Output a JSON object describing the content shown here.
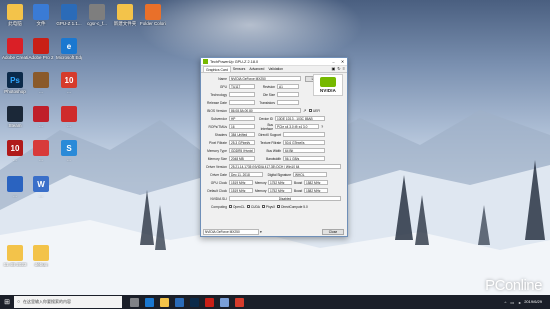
{
  "desktop_icons": [
    {
      "label": "此电脑",
      "color": "#f3c34a"
    },
    {
      "label": "文件",
      "color": "#3a7bd5"
    },
    {
      "label": "GPU-Z 1.1...",
      "color": "#2b6bb8"
    },
    {
      "label": "cgsr-c_f...",
      "color": "#7e7e7e"
    },
    {
      "label": "新建文件夹",
      "color": "#f3c34a"
    },
    {
      "label": "Folder Colorizer BitmapSystem",
      "color": "#e9702a"
    },
    {
      "label": "Adobe Creative Cloud",
      "color": "#da1f26"
    },
    {
      "label": "Adobe Pro 2",
      "color": "#c91f16"
    },
    {
      "label": "Microsoft Edge",
      "color": "#1b78d0"
    },
    {
      "label": "Photoshop",
      "color": "#0b2a4a"
    },
    {
      "label": "...",
      "color": "#8a5a2a"
    },
    {
      "label": "...",
      "color": "#d63b2b"
    },
    {
      "label": "Steam",
      "color": "#1b2838"
    },
    {
      "label": "...",
      "color": "#c01f2a"
    },
    {
      "label": "...",
      "color": "#cf2b2b"
    },
    {
      "label": "...",
      "color": "#b01a1a"
    },
    {
      "label": "...",
      "color": "#d83a3a"
    },
    {
      "label": "...",
      "color": "#2a8ad8"
    },
    {
      "label": "...",
      "color": "#2a63c0"
    },
    {
      "label": "...",
      "color": "#3a6fc9"
    },
    {
      "label": "11.4B 2023",
      "color": "#f3c34a"
    },
    {
      "label": "debug",
      "color": "#f3c34a"
    }
  ],
  "gpuz": {
    "title": "TechPowerUp GPU-Z 2.18.0",
    "tabs": [
      "Graphics Card",
      "Sensors",
      "Advanced",
      "Validation"
    ],
    "lookup_label": "Lookup",
    "logo_text": "NVIDIA",
    "uefi_label": "UEFI",
    "rows": {
      "name": {
        "label": "Name",
        "value": "NVIDIA GeForce MX250"
      },
      "gpu": {
        "label": "GPU",
        "value": "TU117",
        "sub_label": "Revision",
        "sub_value": "A1"
      },
      "technology": {
        "label": "Technology",
        "value": "",
        "sub_label": "Die Size",
        "sub_value": ""
      },
      "release": {
        "label": "Release Date",
        "value": "",
        "sub_label": "Transistors",
        "sub_value": ""
      },
      "bios": {
        "label": "BIOS Version",
        "value": "86.08.5A.00.80"
      },
      "subvendor": {
        "label": "Subvendor",
        "value": "HP",
        "sub_label": "Device ID",
        "sub_value": "10DE 1D13 - 103C 85AB"
      },
      "rops": {
        "label": "ROPs/TMUs",
        "value": "16",
        "sub_label": "Bus Interface",
        "sub_value": "PCIe x4 3.0 @ x4 3.0"
      },
      "shaders": {
        "label": "Shaders",
        "value": "384 Unified",
        "sub_label": "DirectX Support",
        "sub_value": ""
      },
      "pixel": {
        "label": "Pixel Fillrate",
        "value": "25.3 GPixel/s",
        "sub_label": "Texture Fillrate",
        "sub_value": "50.6 GTexel/s"
      },
      "memtype": {
        "label": "Memory Type",
        "value": "GDDR5 (Hynix)",
        "sub_label": "Bus Width",
        "sub_value": "64 Bit"
      },
      "memsize": {
        "label": "Memory Size",
        "value": "2048 MB",
        "sub_label": "Bandwidth",
        "sub_value": "56.1 GB/s"
      },
      "driver": {
        "label": "Driver Version",
        "value": "25.21.14.1735 (NVIDIA 417.35) DCH / Win10 64"
      },
      "driverdate": {
        "label": "Driver Date",
        "value": "Dec 11, 2018",
        "sub_label": "Digital Signature",
        "sub_value": "WHQL"
      },
      "gpuclock": {
        "label": "GPU Clock",
        "value": "1519 MHz",
        "sub_label": "Memory",
        "sub_value": "1752 MHz",
        "sub2_label": "Boost",
        "sub2_value": "1582 MHz"
      },
      "defclock": {
        "label": "Default Clock",
        "value": "1519 MHz",
        "sub_label": "Memory",
        "sub_value": "1752 MHz",
        "sub2_label": "Boost",
        "sub2_value": "1582 MHz"
      },
      "sli": {
        "label": "NVIDIA SLI",
        "value": "Disabled"
      },
      "computing": {
        "label": "Computing",
        "checks": [
          "OpenCL",
          "CUDA",
          "PhysX",
          "DirectCompute 5.0"
        ]
      }
    },
    "footer_select": "NVIDIA GeForce MX250",
    "close_label": "Close"
  },
  "taskbar": {
    "search_placeholder": "在这里输入你要搜索的内容",
    "time": "",
    "date": "2019/6/29",
    "app_colors": [
      "#e6e6e6",
      "#1b78d0",
      "#f3c34a",
      "#2b6bb8",
      "#0b2a4a",
      "#c91f16",
      "#7a9fd8",
      "#d63b2b"
    ]
  },
  "watermark": "PConline"
}
